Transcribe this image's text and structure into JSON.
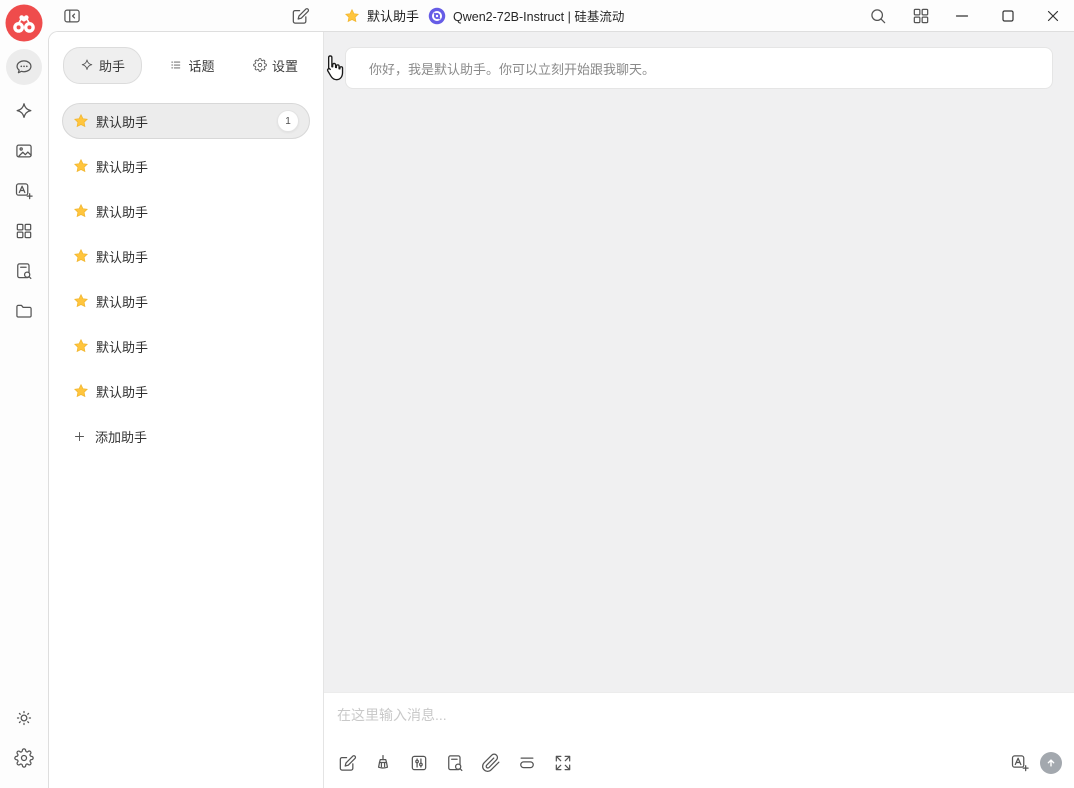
{
  "navbar": {
    "assistant_button_label": "默认助手",
    "model_button_label": "Qwen2-72B-Instruct | 硅基流动",
    "window_controls": [
      "minimize",
      "maximize",
      "close"
    ]
  },
  "sidebar": {
    "items": [
      {
        "icon": "chat-bubble-icon",
        "active": true
      },
      {
        "icon": "sparkle-icon"
      },
      {
        "icon": "image-icon"
      },
      {
        "icon": "translate-icon"
      },
      {
        "icon": "apps-grid-icon"
      },
      {
        "icon": "knowledge-search-icon"
      },
      {
        "icon": "folder-icon"
      }
    ],
    "footer": [
      {
        "icon": "theme-sun-icon"
      },
      {
        "icon": "settings-gear-icon"
      }
    ]
  },
  "assistant_panel": {
    "tabs": [
      {
        "label": "助手",
        "icon": "sparkle-icon",
        "active": true
      },
      {
        "label": "话题",
        "icon": "list-icon",
        "active": false
      },
      {
        "label": "设置",
        "icon": "gear-icon",
        "active": false
      }
    ],
    "items": [
      {
        "label": "默认助手",
        "badge": "1",
        "selected": true
      },
      {
        "label": "默认助手"
      },
      {
        "label": "默认助手"
      },
      {
        "label": "默认助手"
      },
      {
        "label": "默认助手"
      },
      {
        "label": "默认助手"
      },
      {
        "label": "默认助手"
      }
    ],
    "add_button_label": "添加助手"
  },
  "chat": {
    "greeting": "你好，我是默认助手。你可以立刻开始跟我聊天。",
    "input_placeholder": "在这里输入消息...",
    "toolbar_icons": [
      "new-topic-edit-icon",
      "clear-broom-icon",
      "model-sliders-icon",
      "topic-search-icon",
      "attachment-paperclip-icon",
      "clear-context-icon",
      "expand-icon"
    ],
    "right_icons": [
      "translate-icon",
      "send-arrow-icon"
    ]
  },
  "colors": {
    "logo_red": "#ef4c4c",
    "star_gold": "#FFC53D",
    "model_icon_purple": "#665CE6",
    "chat_bg": "#f0f0f1",
    "panel_bg": "#ffffff",
    "border": "#dedede",
    "selected_item_bg": "#ececec",
    "send_button_bg": "#a3a8ae",
    "placeholder_gray": "#c9c9c9"
  }
}
